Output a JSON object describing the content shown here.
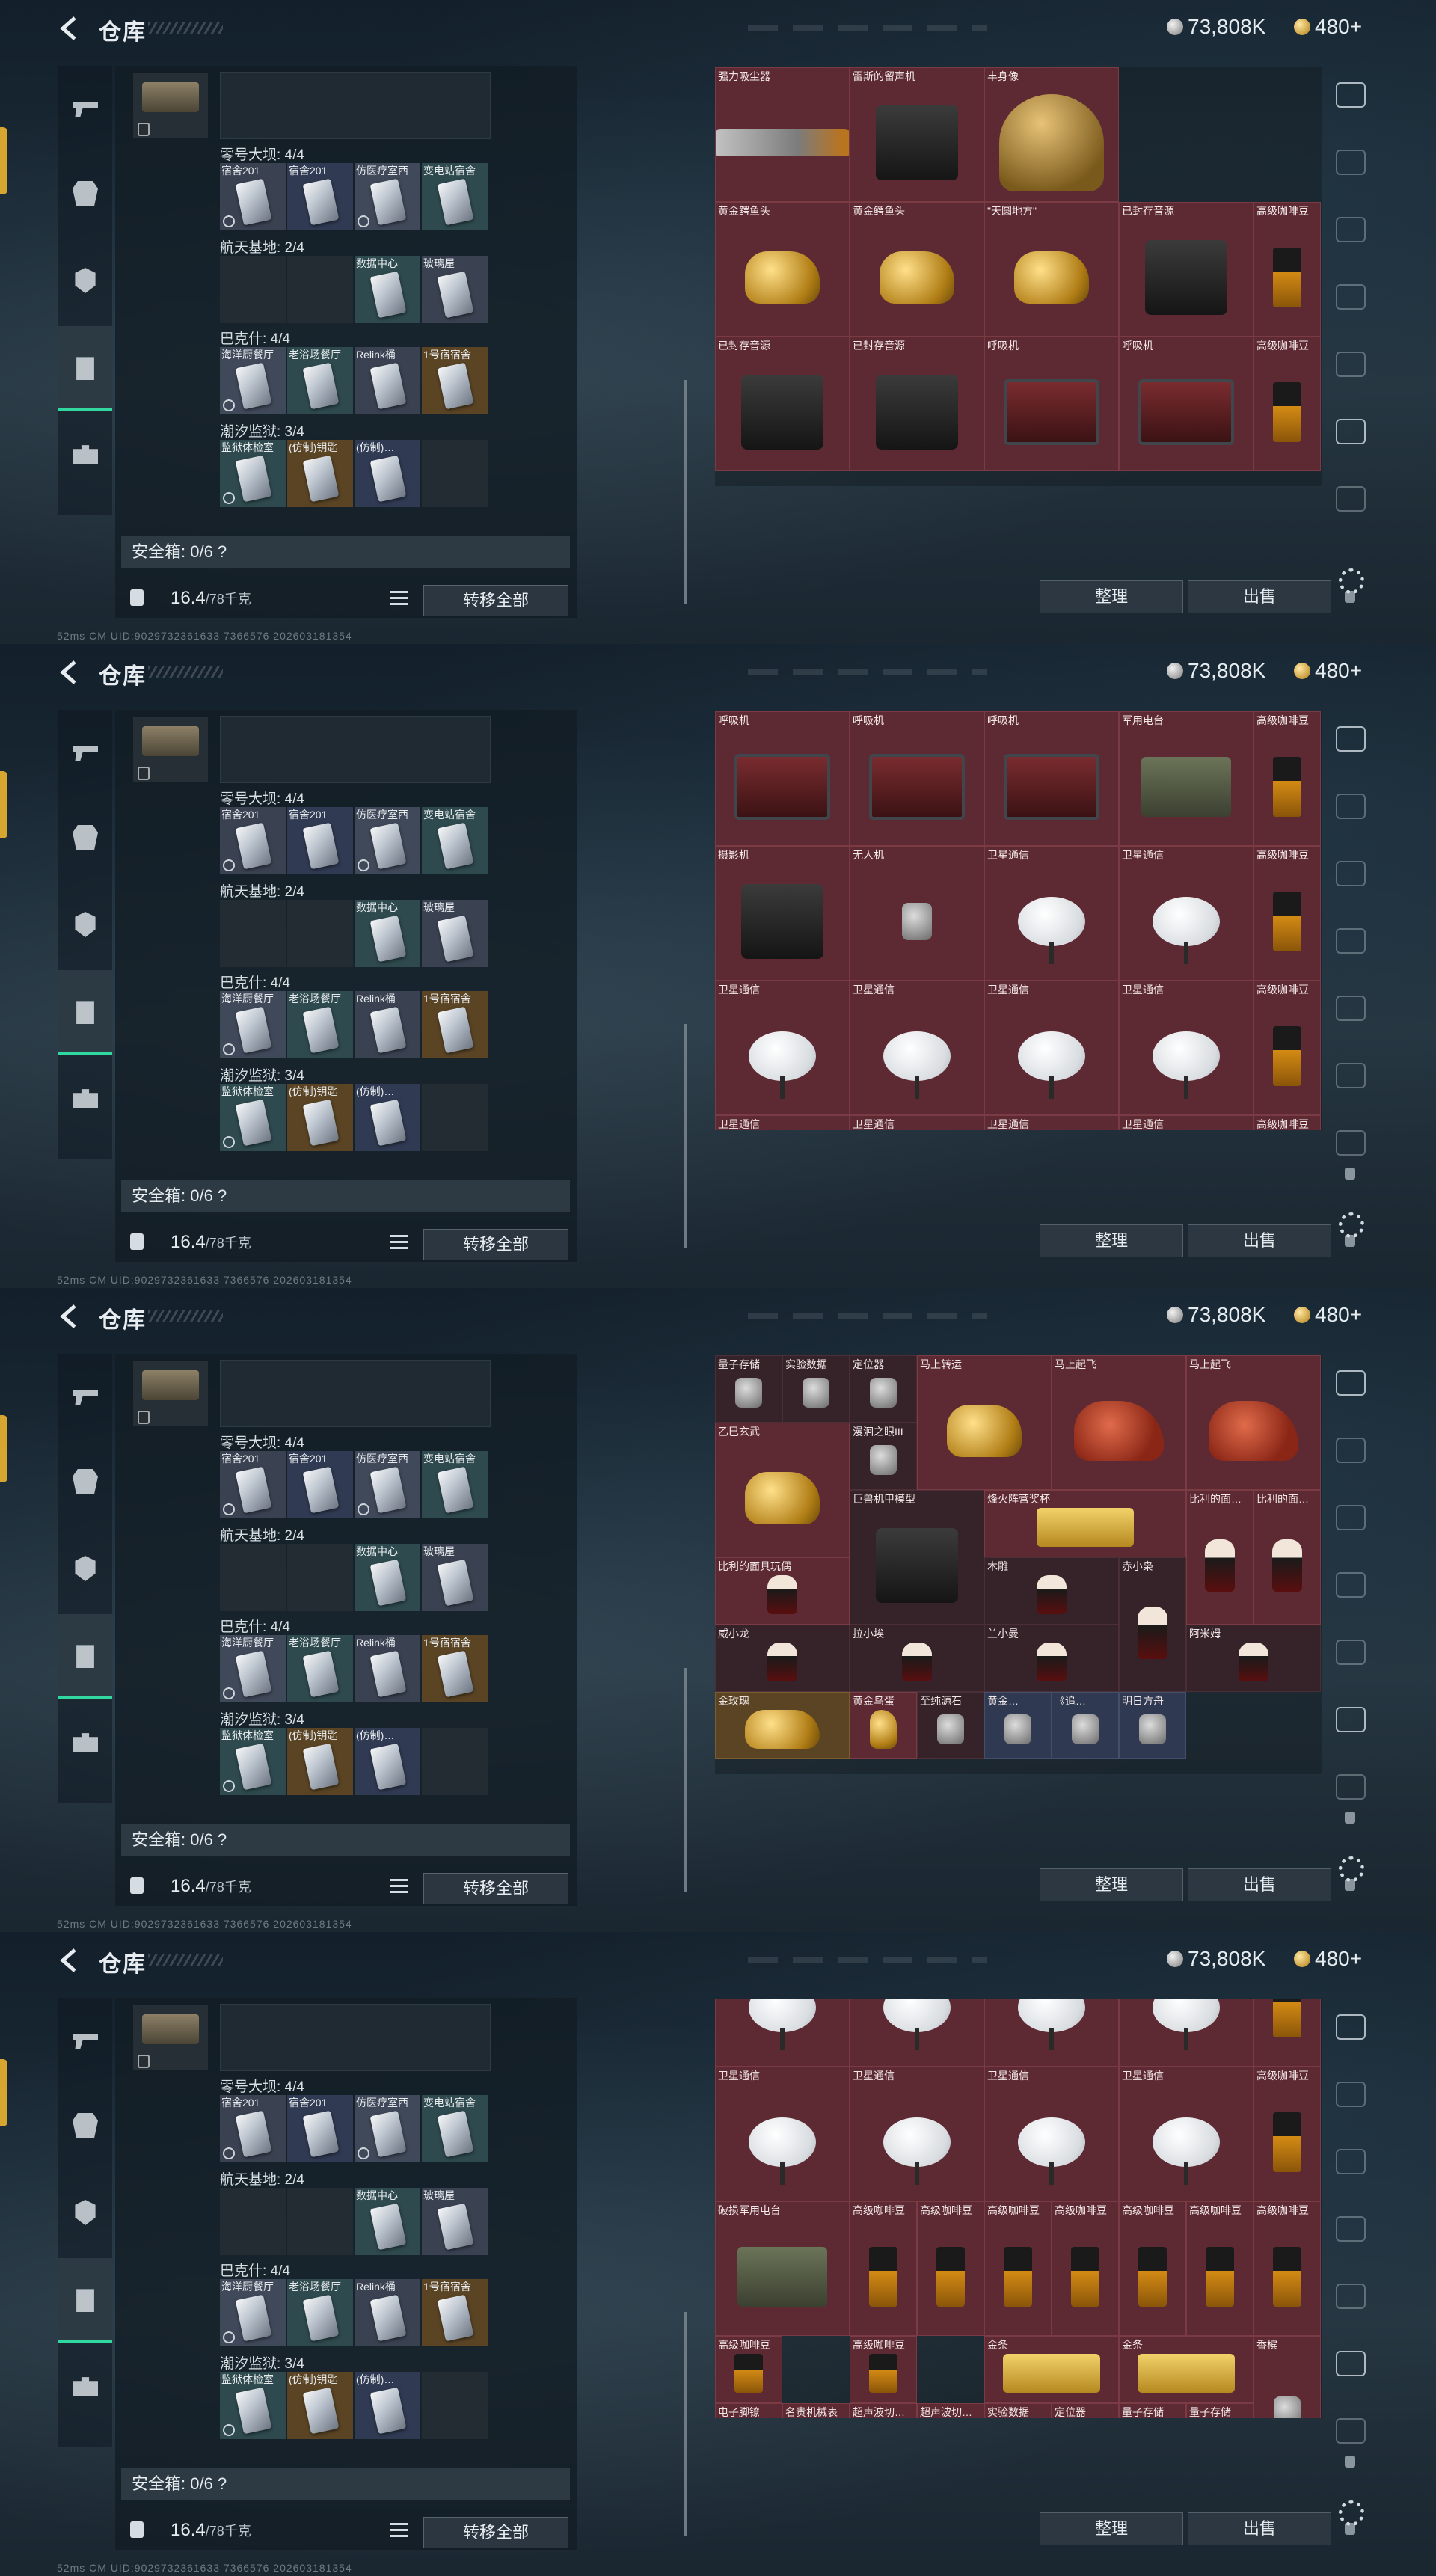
{
  "header": {
    "title": "仓库",
    "silver_currency": "73,808K",
    "gold_currency": "480+"
  },
  "stash": {
    "groups": [
      {
        "label": "零号大坝: 4/4",
        "keys": [
          "宿舍201",
          "宿舍201",
          "仿医疗室西",
          "变电站宿舍"
        ]
      },
      {
        "label": "航天基地: 2/4",
        "keys": [
          "",
          "",
          "数据中心",
          "玻璃屋"
        ]
      },
      {
        "label": "巴克什: 4/4",
        "keys": [
          "海洋厨餐厅",
          "老浴场餐厅",
          "Relink桶",
          "1号宿宿舍"
        ]
      },
      {
        "label": "潮汐监狱: 3/4",
        "keys": [
          "监狱体检室",
          "(仿制)钥匙",
          "(仿制)…",
          ""
        ]
      }
    ],
    "safe_box": "安全箱: 0/6 ?",
    "weight": "16.4",
    "weight_unit": "/78千克",
    "transfer_all": "转移全部"
  },
  "buttons": {
    "sort": "整理",
    "sell": "出售"
  },
  "footer_uid": "52ms  CM UID:9029732361633 7366576  202603181354",
  "panels": [
    {
      "cells": [
        {
          "name": "强力吸尘器",
          "art": "vac",
          "cls": "",
          "c": 0,
          "r": 0,
          "w": 2,
          "h": 2
        },
        {
          "name": "雷斯的留声机",
          "art": "reel",
          "cls": "",
          "c": 2,
          "r": 0,
          "w": 2,
          "h": 2
        },
        {
          "name": "丰身像",
          "art": "bust",
          "cls": "",
          "c": 4,
          "r": 0,
          "w": 2,
          "h": 2
        },
        {
          "name": "黄金鳄鱼头",
          "art": "gold",
          "cls": "",
          "c": 0,
          "r": 2,
          "w": 2,
          "h": 2
        },
        {
          "name": "黄金鳄鱼头",
          "art": "gold",
          "cls": "",
          "c": 2,
          "r": 2,
          "w": 2,
          "h": 2
        },
        {
          "name": "\"天圆地方\"",
          "art": "gold",
          "cls": "",
          "c": 4,
          "r": 2,
          "w": 2,
          "h": 2
        },
        {
          "name": "已封存音源",
          "art": "reel",
          "cls": "",
          "c": 6,
          "r": 2,
          "w": 2,
          "h": 2
        },
        {
          "name": "高级咖啡豆",
          "art": "coffee",
          "cls": "",
          "c": 8,
          "r": 2,
          "w": 1,
          "h": 2
        },
        {
          "name": "已封存音源",
          "art": "reel",
          "cls": "",
          "c": 0,
          "r": 4,
          "w": 2,
          "h": 2
        },
        {
          "name": "已封存音源",
          "art": "reel",
          "cls": "",
          "c": 2,
          "r": 4,
          "w": 2,
          "h": 2
        },
        {
          "name": "呼吸机",
          "art": "box",
          "cls": "",
          "c": 4,
          "r": 4,
          "w": 2,
          "h": 2
        },
        {
          "name": "呼吸机",
          "art": "box",
          "cls": "",
          "c": 6,
          "r": 4,
          "w": 2,
          "h": 2
        },
        {
          "name": "高级咖啡豆",
          "art": "coffee",
          "cls": "",
          "c": 8,
          "r": 4,
          "w": 1,
          "h": 2
        }
      ]
    },
    {
      "cells": [
        {
          "name": "呼吸机",
          "art": "box",
          "cls": "",
          "c": 0,
          "r": 0,
          "w": 2,
          "h": 2
        },
        {
          "name": "呼吸机",
          "art": "box",
          "cls": "",
          "c": 2,
          "r": 0,
          "w": 2,
          "h": 2
        },
        {
          "name": "呼吸机",
          "art": "box",
          "cls": "",
          "c": 4,
          "r": 0,
          "w": 2,
          "h": 2
        },
        {
          "name": "军用电台",
          "art": "radio",
          "cls": "",
          "c": 6,
          "r": 0,
          "w": 2,
          "h": 2
        },
        {
          "name": "高级咖啡豆",
          "art": "coffee",
          "cls": "",
          "c": 8,
          "r": 0,
          "w": 1,
          "h": 2
        },
        {
          "name": "摄影机",
          "art": "reel",
          "cls": "",
          "c": 0,
          "r": 2,
          "w": 2,
          "h": 2
        },
        {
          "name": "无人机",
          "art": "small",
          "cls": "",
          "c": 2,
          "r": 2,
          "w": 2,
          "h": 2
        },
        {
          "name": "卫星通信",
          "art": "dish",
          "cls": "",
          "c": 4,
          "r": 2,
          "w": 2,
          "h": 2
        },
        {
          "name": "卫星通信",
          "art": "dish",
          "cls": "",
          "c": 6,
          "r": 2,
          "w": 2,
          "h": 2
        },
        {
          "name": "高级咖啡豆",
          "art": "coffee",
          "cls": "",
          "c": 8,
          "r": 2,
          "w": 1,
          "h": 2
        },
        {
          "name": "卫星通信",
          "art": "dish",
          "cls": "",
          "c": 0,
          "r": 4,
          "w": 2,
          "h": 2
        },
        {
          "name": "卫星通信",
          "art": "dish",
          "cls": "",
          "c": 2,
          "r": 4,
          "w": 2,
          "h": 2
        },
        {
          "name": "卫星通信",
          "art": "dish",
          "cls": "",
          "c": 4,
          "r": 4,
          "w": 2,
          "h": 2
        },
        {
          "name": "卫星通信",
          "art": "dish",
          "cls": "",
          "c": 6,
          "r": 4,
          "w": 2,
          "h": 2
        },
        {
          "name": "高级咖啡豆",
          "art": "coffee",
          "cls": "",
          "c": 8,
          "r": 4,
          "w": 1,
          "h": 2
        },
        {
          "name": "卫星通信",
          "art": "dish",
          "cls": "",
          "c": 0,
          "r": 6,
          "w": 2,
          "h": 2
        },
        {
          "name": "卫星通信",
          "art": "dish",
          "cls": "",
          "c": 2,
          "r": 6,
          "w": 2,
          "h": 2
        },
        {
          "name": "卫星通信",
          "art": "dish",
          "cls": "",
          "c": 4,
          "r": 6,
          "w": 2,
          "h": 2
        },
        {
          "name": "卫星通信",
          "art": "dish",
          "cls": "",
          "c": 6,
          "r": 6,
          "w": 2,
          "h": 2
        },
        {
          "name": "高级咖啡豆",
          "art": "coffee",
          "cls": "",
          "c": 8,
          "r": 6,
          "w": 1,
          "h": 2
        }
      ]
    },
    {
      "cells": [
        {
          "name": "量子存储",
          "art": "small",
          "cls": "dark",
          "c": 0,
          "r": 0,
          "w": 1,
          "h": 1
        },
        {
          "name": "实验数据",
          "art": "small",
          "cls": "dark",
          "c": 1,
          "r": 0,
          "w": 1,
          "h": 1
        },
        {
          "name": "定位器",
          "art": "small",
          "cls": "dark",
          "c": 2,
          "r": 0,
          "w": 1,
          "h": 1
        },
        {
          "name": "马上转运",
          "art": "gold",
          "cls": "",
          "c": 3,
          "r": 0,
          "w": 2,
          "h": 2
        },
        {
          "name": "马上起飞",
          "art": "red",
          "cls": "",
          "c": 5,
          "r": 0,
          "w": 2,
          "h": 2
        },
        {
          "name": "马上起飞",
          "art": "red",
          "cls": "",
          "c": 7,
          "r": 0,
          "w": 2,
          "h": 2
        },
        {
          "name": "乙巳玄武",
          "art": "gold",
          "cls": "",
          "c": 0,
          "r": 1,
          "w": 2,
          "h": 2
        },
        {
          "name": "漫洄之眼III",
          "art": "small",
          "cls": "dark",
          "c": 2,
          "r": 1,
          "w": 1,
          "h": 1
        },
        {
          "name": "巨兽机甲模型",
          "art": "reel",
          "cls": "dark",
          "c": 2,
          "r": 2,
          "w": 2,
          "h": 2
        },
        {
          "name": "烽火阵营奖杯",
          "art": "bar",
          "cls": "",
          "c": 4,
          "r": 2,
          "w": 3,
          "h": 1
        },
        {
          "name": "比利的面…",
          "art": "fig",
          "cls": "",
          "c": 7,
          "r": 2,
          "w": 1,
          "h": 2
        },
        {
          "name": "比利的面…",
          "art": "fig",
          "cls": "",
          "c": 8,
          "r": 2,
          "w": 1,
          "h": 2
        },
        {
          "name": "比利的面具玩偶",
          "art": "fig",
          "cls": "",
          "c": 0,
          "r": 3,
          "w": 2,
          "h": 1
        },
        {
          "name": "木雕",
          "art": "fig",
          "cls": "dark",
          "c": 4,
          "r": 3,
          "w": 2,
          "h": 1
        },
        {
          "name": "赤小枭",
          "art": "fig",
          "cls": "dark",
          "c": 6,
          "r": 3,
          "w": 1,
          "h": 2
        },
        {
          "name": "威小龙",
          "art": "fig",
          "cls": "dark",
          "c": 0,
          "r": 4,
          "w": 2,
          "h": 1
        },
        {
          "name": "拉小埃",
          "art": "fig",
          "cls": "dark",
          "c": 2,
          "r": 4,
          "w": 2,
          "h": 1
        },
        {
          "name": "兰小曼",
          "art": "fig",
          "cls": "dark",
          "c": 4,
          "r": 4,
          "w": 2,
          "h": 1
        },
        {
          "name": "阿米姆",
          "art": "fig",
          "cls": "dark",
          "c": 7,
          "r": 4,
          "w": 2,
          "h": 1
        },
        {
          "name": "金玫瑰",
          "art": "gold",
          "cls": "gold",
          "c": 0,
          "r": 5,
          "w": 2,
          "h": 1
        },
        {
          "name": "黄金鸟蛋",
          "art": "gold",
          "cls": "",
          "c": 2,
          "r": 5,
          "w": 1,
          "h": 1
        },
        {
          "name": "至纯源石",
          "art": "small",
          "cls": "dark",
          "c": 3,
          "r": 5,
          "w": 1,
          "h": 1
        },
        {
          "name": "黄金…",
          "art": "small",
          "cls": "navy",
          "c": 4,
          "r": 5,
          "w": 1,
          "h": 1
        },
        {
          "name": "《追…",
          "art": "small",
          "cls": "navy",
          "c": 5,
          "r": 5,
          "w": 1,
          "h": 1
        },
        {
          "name": "明日方舟",
          "art": "small",
          "cls": "navy",
          "c": 6,
          "r": 5,
          "w": 1,
          "h": 1
        }
      ]
    },
    {
      "cells": [
        {
          "name": "",
          "art": "dish",
          "cls": "",
          "c": 0,
          "r": -1,
          "w": 2,
          "h": 2
        },
        {
          "name": "",
          "art": "dish",
          "cls": "",
          "c": 2,
          "r": -1,
          "w": 2,
          "h": 2
        },
        {
          "name": "",
          "art": "dish",
          "cls": "",
          "c": 4,
          "r": -1,
          "w": 2,
          "h": 2
        },
        {
          "name": "",
          "art": "dish",
          "cls": "",
          "c": 6,
          "r": -1,
          "w": 2,
          "h": 2
        },
        {
          "name": "",
          "art": "coffee",
          "cls": "",
          "c": 8,
          "r": -1,
          "w": 1,
          "h": 2
        },
        {
          "name": "卫星通信",
          "art": "dish",
          "cls": "",
          "c": 0,
          "r": 1,
          "w": 2,
          "h": 2
        },
        {
          "name": "卫星通信",
          "art": "dish",
          "cls": "",
          "c": 2,
          "r": 1,
          "w": 2,
          "h": 2
        },
        {
          "name": "卫星通信",
          "art": "dish",
          "cls": "",
          "c": 4,
          "r": 1,
          "w": 2,
          "h": 2
        },
        {
          "name": "卫星通信",
          "art": "dish",
          "cls": "",
          "c": 6,
          "r": 1,
          "w": 2,
          "h": 2
        },
        {
          "name": "高级咖啡豆",
          "art": "coffee",
          "cls": "",
          "c": 8,
          "r": 1,
          "w": 1,
          "h": 2
        },
        {
          "name": "破损军用电台",
          "art": "radio",
          "cls": "",
          "c": 0,
          "r": 3,
          "w": 2,
          "h": 2
        },
        {
          "name": "高级咖啡豆",
          "art": "coffee",
          "cls": "",
          "c": 2,
          "r": 3,
          "w": 1,
          "h": 2
        },
        {
          "name": "高级咖啡豆",
          "art": "coffee",
          "cls": "",
          "c": 3,
          "r": 3,
          "w": 1,
          "h": 2
        },
        {
          "name": "高级咖啡豆",
          "art": "coffee",
          "cls": "",
          "c": 4,
          "r": 3,
          "w": 1,
          "h": 2
        },
        {
          "name": "高级咖啡豆",
          "art": "coffee",
          "cls": "",
          "c": 5,
          "r": 3,
          "w": 1,
          "h": 2
        },
        {
          "name": "高级咖啡豆",
          "art": "coffee",
          "cls": "",
          "c": 6,
          "r": 3,
          "w": 1,
          "h": 2
        },
        {
          "name": "高级咖啡豆",
          "art": "coffee",
          "cls": "",
          "c": 7,
          "r": 3,
          "w": 1,
          "h": 2
        },
        {
          "name": "高级咖啡豆",
          "art": "coffee",
          "cls": "",
          "c": 8,
          "r": 3,
          "w": 1,
          "h": 2
        },
        {
          "name": "高级咖啡豆",
          "art": "coffee",
          "cls": "",
          "c": 0,
          "r": 5,
          "w": 1,
          "h": 1
        },
        {
          "name": "高级咖啡豆",
          "art": "coffee",
          "cls": "",
          "c": 2,
          "r": 5,
          "w": 1,
          "h": 1
        },
        {
          "name": "金条",
          "art": "bar",
          "cls": "",
          "c": 4,
          "r": 5,
          "w": 2,
          "h": 1
        },
        {
          "name": "金条",
          "art": "bar",
          "cls": "",
          "c": 6,
          "r": 5,
          "w": 2,
          "h": 1
        },
        {
          "name": "香槟",
          "art": "small",
          "cls": "",
          "c": 8,
          "r": 5,
          "w": 1,
          "h": 2
        },
        {
          "name": "电子脚镣",
          "art": "small",
          "cls": "",
          "c": 0,
          "r": 6,
          "w": 1,
          "h": 1
        },
        {
          "name": "名贵机械表",
          "art": "small",
          "cls": "",
          "c": 1,
          "r": 6,
          "w": 1,
          "h": 1
        },
        {
          "name": "超声波切…",
          "art": "small",
          "cls": "",
          "c": 2,
          "r": 6,
          "w": 1,
          "h": 1
        },
        {
          "name": "超声波切…",
          "art": "small",
          "cls": "",
          "c": 3,
          "r": 6,
          "w": 1,
          "h": 1
        },
        {
          "name": "实验数据",
          "art": "small",
          "cls": "",
          "c": 4,
          "r": 6,
          "w": 1,
          "h": 1
        },
        {
          "name": "定位器",
          "art": "small",
          "cls": "",
          "c": 5,
          "r": 6,
          "w": 1,
          "h": 1
        },
        {
          "name": "量子存储",
          "art": "small",
          "cls": "",
          "c": 6,
          "r": 6,
          "w": 1,
          "h": 1
        },
        {
          "name": "量子存储",
          "art": "small",
          "cls": "",
          "c": 7,
          "r": 6,
          "w": 1,
          "h": 1
        }
      ]
    }
  ]
}
